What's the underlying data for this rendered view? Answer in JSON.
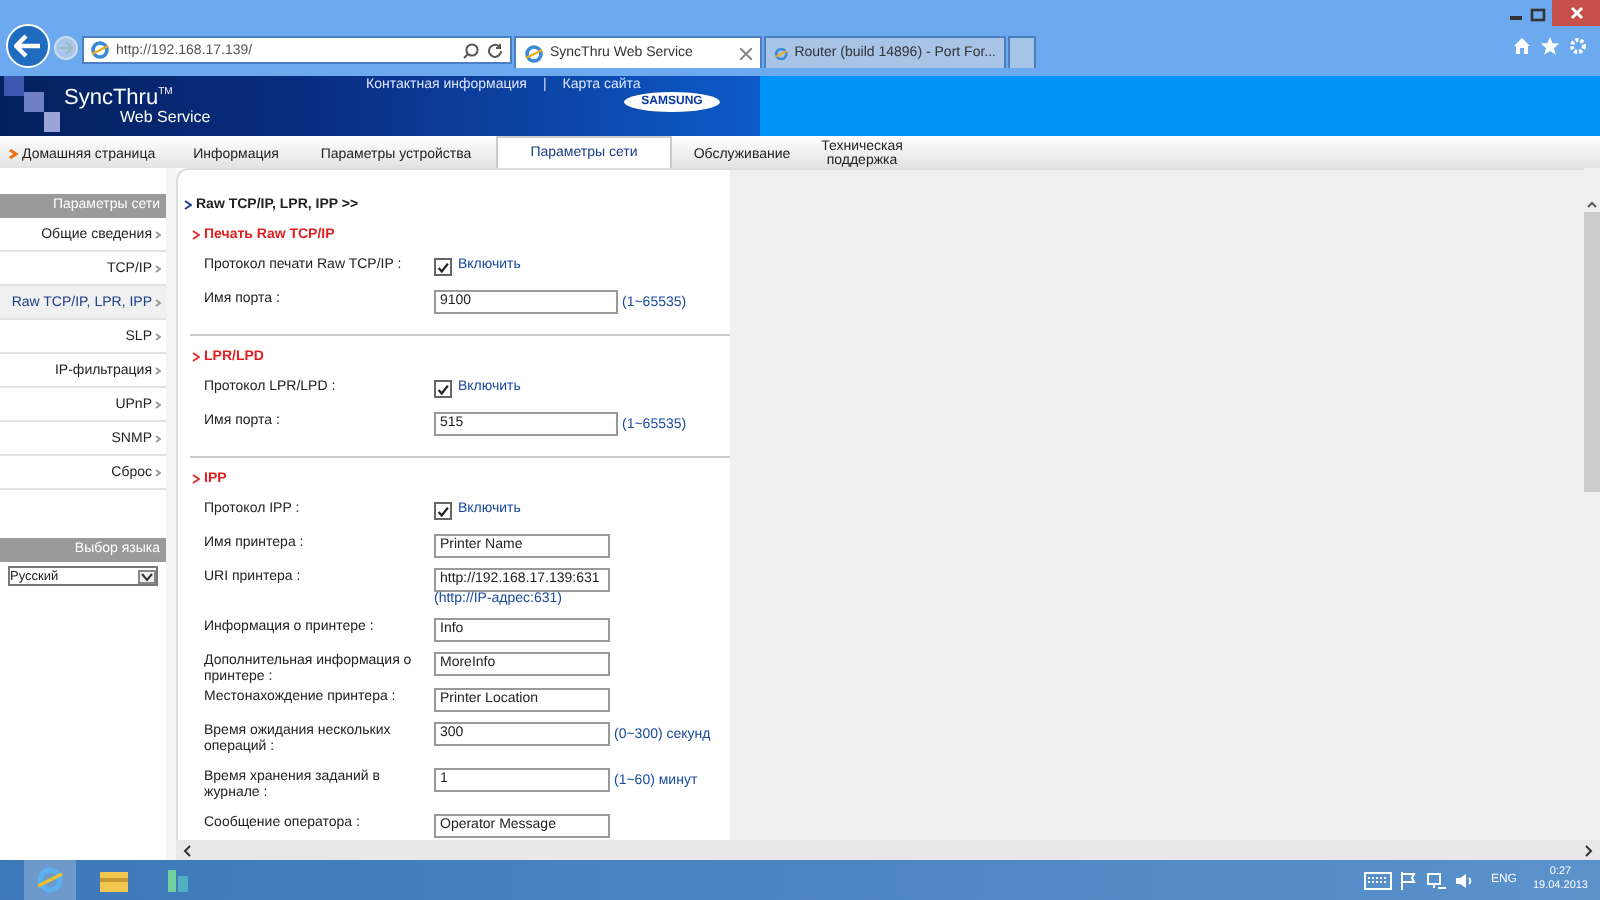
{
  "browser": {
    "address": "http://192.168.17.139/",
    "tabs": [
      {
        "title": "SyncThru Web Service",
        "selected": true
      },
      {
        "title": "Router (build 14896) - Port For...",
        "selected": false
      }
    ]
  },
  "header": {
    "logo": "SyncThru",
    "logo_mark": "TM",
    "logo_sub": "Web Service",
    "links": [
      "Контактная информация",
      "Карта сайта"
    ],
    "separator": "|",
    "brand": "SAMSUNG"
  },
  "nav": {
    "home": "Домашняя страница",
    "tabs": [
      {
        "label": "Информация",
        "selected": false
      },
      {
        "label": "Параметры устройства",
        "selected": false
      },
      {
        "label": "Параметры сети",
        "selected": true
      },
      {
        "label": "Обслуживание",
        "selected": false
      },
      {
        "label": "Техническая поддержка",
        "selected": false
      }
    ]
  },
  "sidebar": {
    "title": "Параметры сети",
    "items": [
      {
        "label": "Общие сведения",
        "selected": false
      },
      {
        "label": "TCP/IP",
        "selected": false
      },
      {
        "label": "Raw TCP/IP, LPR, IPP",
        "selected": true
      },
      {
        "label": "SLP",
        "selected": false
      },
      {
        "label": "IP-фильтрация",
        "selected": false
      },
      {
        "label": "UPnP",
        "selected": false
      },
      {
        "label": "SNMP",
        "selected": false
      },
      {
        "label": "Сброс",
        "selected": false
      }
    ],
    "language_title": "Выбор языка",
    "language": "Русский"
  },
  "breadcrumb": "Raw TCP/IP, LPR, IPP >>",
  "sections": [
    {
      "title": "Печать Raw TCP/IP",
      "rows": [
        {
          "kind": "checkbox",
          "label": "Протокол печати Raw TCP/IP :",
          "checked": true,
          "option": "Включить"
        },
        {
          "kind": "field",
          "label": "Имя порта :",
          "value": "9100",
          "hint": "(1~65535)"
        }
      ]
    },
    {
      "title": "LPR/LPD",
      "rows": [
        {
          "kind": "checkbox",
          "label": "Протокол LPR/LPD :",
          "checked": true,
          "option": "Включить"
        },
        {
          "kind": "field",
          "label": "Имя порта :",
          "value": "515",
          "hint": "(1~65535)"
        }
      ]
    },
    {
      "title": "IPP",
      "rows": [
        {
          "kind": "checkbox",
          "label": "Протокол IPP :",
          "checked": true,
          "option": "Включить"
        },
        {
          "kind": "field",
          "label": "Имя принтера :",
          "value": "Printer Name"
        },
        {
          "kind": "field",
          "label": "URI принтера :",
          "value": "http://192.168.17.139:631",
          "note": "(http://IP-адрес:631)"
        },
        {
          "kind": "field",
          "label": "Информация о принтере :",
          "value": "Info"
        },
        {
          "kind": "field",
          "label": "Дополнительная информация о принтере :",
          "value": "MoreInfo"
        },
        {
          "kind": "field",
          "label": "Местонахождение принтера :",
          "value": "Printer Location"
        },
        {
          "kind": "field",
          "label": "Время ожидания нескольких операций :",
          "value": "300",
          "hint": "(0~300) секунд"
        },
        {
          "kind": "field",
          "label": "Время хранения заданий в журнале :",
          "value": "1",
          "hint": "(1~60) минут"
        },
        {
          "kind": "field",
          "label": "Сообщение оператора :",
          "value": "Operator Message"
        }
      ]
    }
  ],
  "taskbar": {
    "language": "ENG",
    "time": "0:27",
    "date": "19.04.2013"
  }
}
